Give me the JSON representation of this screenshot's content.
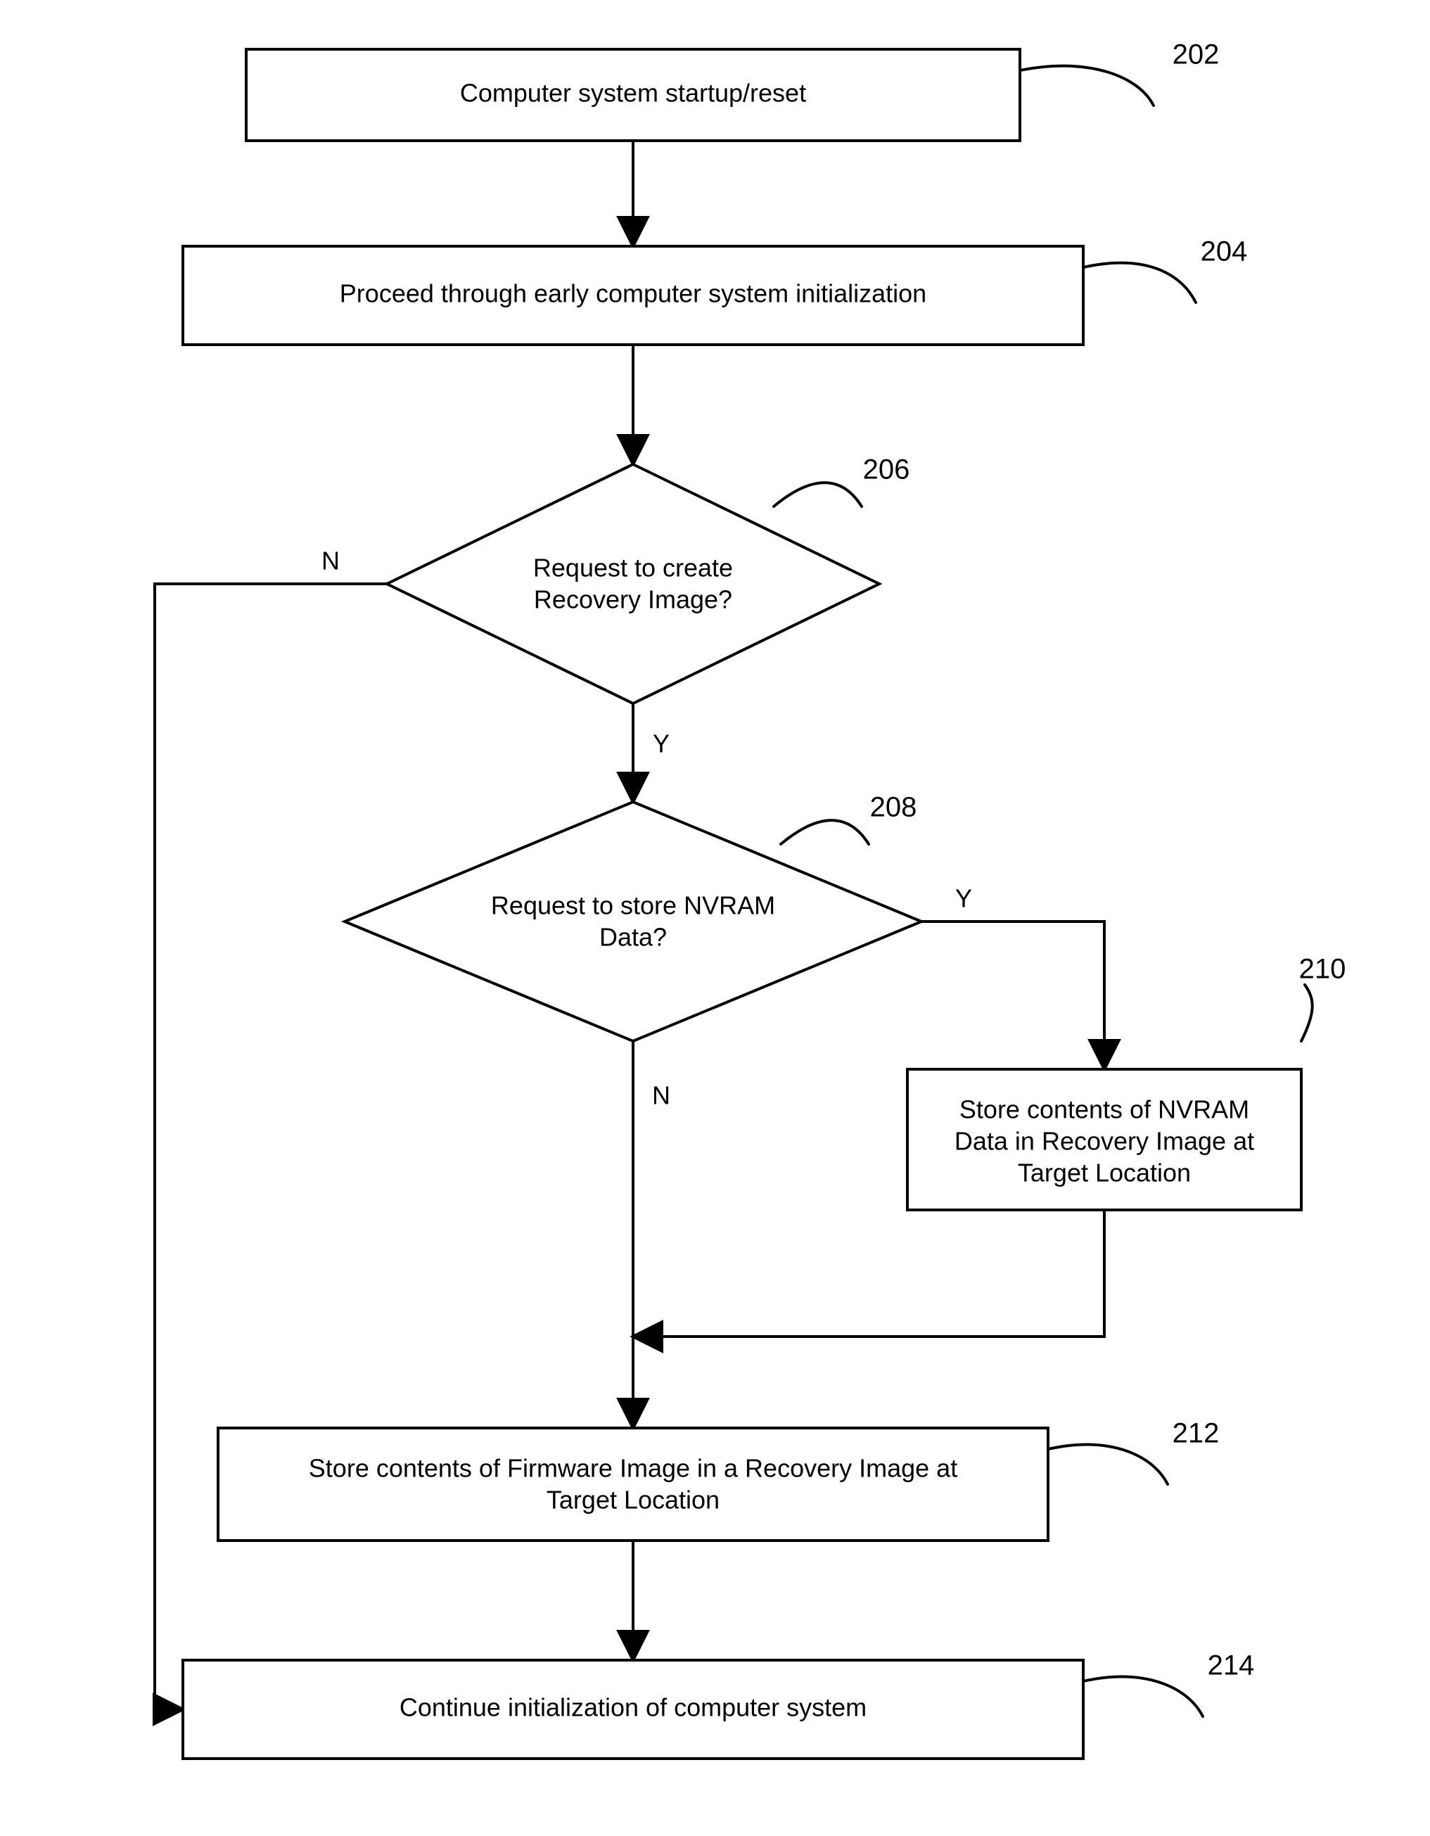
{
  "nodes": {
    "n202": {
      "text": "Computer system startup/reset",
      "label": "202"
    },
    "n204": {
      "text": "Proceed through early computer system initialization",
      "label": "204"
    },
    "n206": {
      "line1": "Request to create",
      "line2": "Recovery Image?",
      "label": "206"
    },
    "n208": {
      "line1": "Request to store NVRAM",
      "line2": "Data?",
      "label": "208"
    },
    "n210": {
      "line1": "Store contents of NVRAM",
      "line2": "Data in Recovery Image at",
      "line3": "Target Location",
      "label": "210"
    },
    "n212": {
      "line1": "Store contents of Firmware Image in a Recovery Image at",
      "line2": "Target Location",
      "label": "212"
    },
    "n214": {
      "text": "Continue initialization of computer system",
      "label": "214"
    }
  },
  "edges": {
    "yes": "Y",
    "no": "N"
  }
}
